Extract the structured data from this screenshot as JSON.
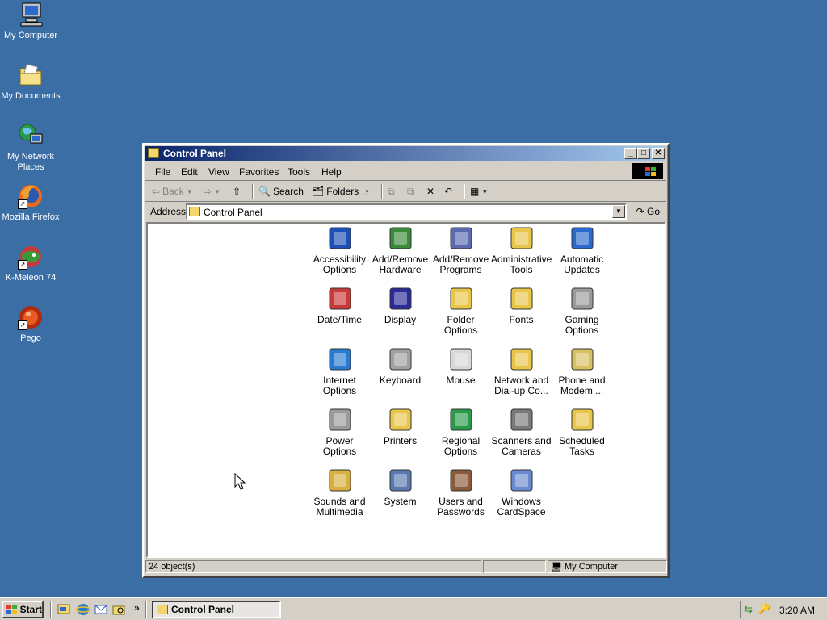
{
  "desktop": {
    "icons": [
      {
        "label": "My Computer",
        "icon": "computer-icon"
      },
      {
        "label": "My Documents",
        "icon": "documents-folder-icon"
      },
      {
        "label": "My Network Places",
        "icon": "network-icon"
      },
      {
        "label": "Mozilla Firefox",
        "icon": "firefox-icon"
      },
      {
        "label": "K-Meleon 74",
        "icon": "kmeleon-icon"
      },
      {
        "label": "Pego",
        "icon": "pego-icon"
      }
    ]
  },
  "window": {
    "title": "Control Panel",
    "buttons": {
      "minimize": "_",
      "maximize": "□",
      "close": "✕"
    },
    "menu": [
      "File",
      "Edit",
      "View",
      "Favorites",
      "Tools",
      "Help"
    ],
    "toolbar": {
      "back": "Back",
      "search": "Search",
      "folders": "Folders"
    },
    "address": {
      "label": "Address",
      "value": "Control Panel",
      "go": "Go"
    },
    "items": [
      {
        "label": "Accessibility Options",
        "icon": "accessibility-icon",
        "color": "#1e4fb5"
      },
      {
        "label": "Add/Remove Hardware",
        "icon": "hardware-icon",
        "color": "#3a8a3a"
      },
      {
        "label": "Add/Remove Programs",
        "icon": "programs-icon",
        "color": "#5a6ab0"
      },
      {
        "label": "Administrative Tools",
        "icon": "admin-tools-icon",
        "color": "#e8c64a"
      },
      {
        "label": "Automatic Updates",
        "icon": "windows-update-icon",
        "color": "#2a6ad0"
      },
      {
        "label": "Date/Time",
        "icon": "clock-icon",
        "color": "#c83a3a"
      },
      {
        "label": "Display",
        "icon": "monitor-icon",
        "color": "#2a2a9a"
      },
      {
        "label": "Folder Options",
        "icon": "folder-options-icon",
        "color": "#e8c64a"
      },
      {
        "label": "Fonts",
        "icon": "fonts-icon",
        "color": "#e8c64a"
      },
      {
        "label": "Gaming Options",
        "icon": "joystick-icon",
        "color": "#9a9a9a"
      },
      {
        "label": "Internet Options",
        "icon": "globe-icon",
        "color": "#2a7ad0"
      },
      {
        "label": "Keyboard",
        "icon": "keyboard-icon",
        "color": "#a0a0a0"
      },
      {
        "label": "Mouse",
        "icon": "mouse-icon",
        "color": "#d8d8d8"
      },
      {
        "label": "Network and Dial-up Co...",
        "icon": "network-connections-icon",
        "color": "#e8c64a"
      },
      {
        "label": "Phone and Modem ...",
        "icon": "phone-icon",
        "color": "#d8c060"
      },
      {
        "label": "Power Options",
        "icon": "power-icon",
        "color": "#9a9a9a"
      },
      {
        "label": "Printers",
        "icon": "printer-folder-icon",
        "color": "#e8c64a"
      },
      {
        "label": "Regional Options",
        "icon": "earth-icon",
        "color": "#2a9a4a"
      },
      {
        "label": "Scanners and Cameras",
        "icon": "scanner-icon",
        "color": "#7a7a7a"
      },
      {
        "label": "Scheduled Tasks",
        "icon": "scheduled-tasks-icon",
        "color": "#e8c64a"
      },
      {
        "label": "Sounds and Multimedia",
        "icon": "speaker-icon",
        "color": "#d8b040"
      },
      {
        "label": "System",
        "icon": "system-icon",
        "color": "#5a7ab0"
      },
      {
        "label": "Users and Passwords",
        "icon": "users-icon",
        "color": "#8a5a3a"
      },
      {
        "label": "Windows CardSpace",
        "icon": "cardspace-icon",
        "color": "#6a8ad0"
      }
    ],
    "status": {
      "objects": "24 object(s)",
      "zone": "My Computer"
    }
  },
  "taskbar": {
    "start": "Start",
    "task": "Control Panel",
    "chevron": "»",
    "clock": "3:20 AM"
  },
  "colors": {
    "desktop": "#3a6ea5",
    "titlebar_start": "#0a246a",
    "titlebar_end": "#a6caf0",
    "chrome": "#d4d0c8"
  }
}
